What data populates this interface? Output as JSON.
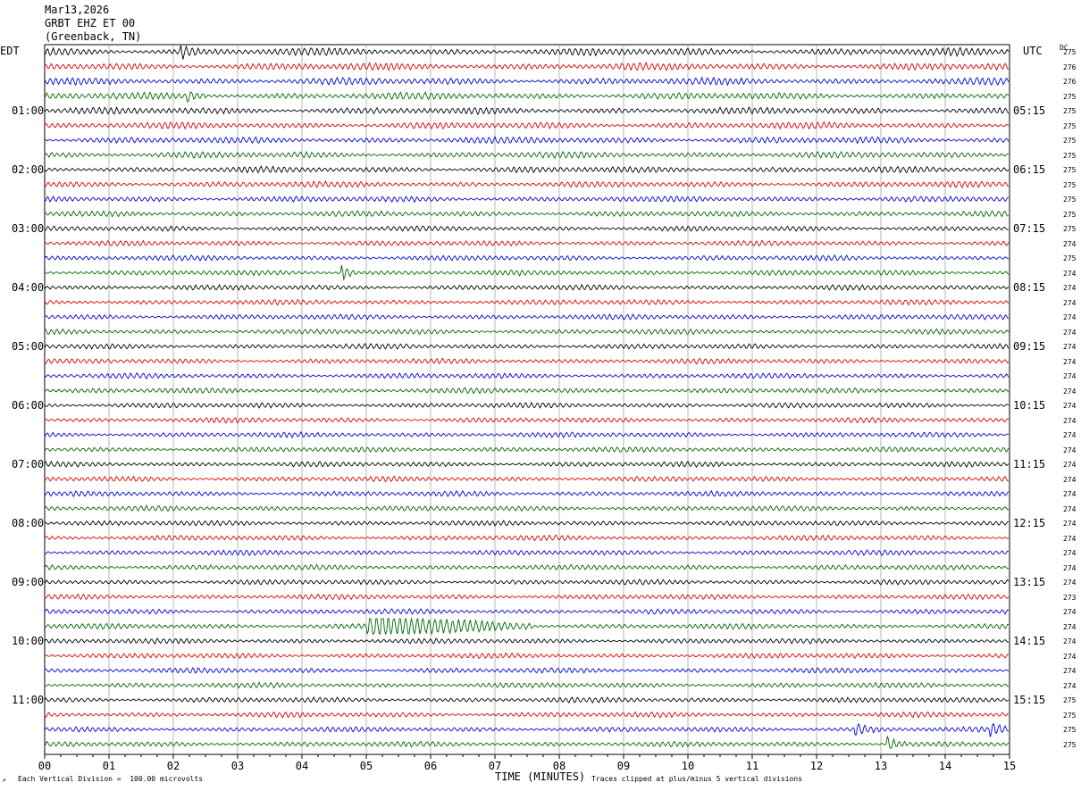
{
  "header": {
    "date": "Mar13,2026",
    "station": "GRBT EHZ ET 00",
    "location": "(Greenback, TN)"
  },
  "left_zone": "EDT",
  "right_zone": "UTC",
  "dc_header": "DC",
  "footer": {
    "scale_note": "Each Vertical Division =  100.00 microvolts",
    "xlabel": "TIME (MINUTES)",
    "clip_note": "Traces clipped at plus/minus 5 vertical divisions"
  },
  "colors": {
    "line_cycle": [
      "#000000",
      "#dd0000",
      "#0000dd",
      "#006600"
    ],
    "grid": "#888888"
  },
  "chart_data": {
    "type": "line",
    "title": "",
    "xlabel": "TIME (MINUTES)",
    "xlim": [
      0,
      15
    ],
    "x_ticks": [
      "00",
      "01",
      "02",
      "03",
      "04",
      "05",
      "06",
      "07",
      "08",
      "09",
      "10",
      "11",
      "12",
      "13",
      "14",
      "15"
    ],
    "trace_count": 48,
    "left_time_labels": [
      "01:00",
      "02:00",
      "03:00",
      "04:00",
      "05:00",
      "06:00",
      "07:00",
      "08:00",
      "09:00",
      "10:00",
      "11:00"
    ],
    "right_time_labels": [
      "05:15",
      "06:15",
      "07:15",
      "08:15",
      "09:15",
      "10:15",
      "11:15",
      "12:15",
      "13:15",
      "14:15",
      "15:15"
    ],
    "dc_values": [
      "275",
      "276",
      "276",
      "275",
      "275",
      "275",
      "275",
      "275",
      "275",
      "275",
      "275",
      "275",
      "275",
      "274",
      "275",
      "274",
      "274",
      "274",
      "274",
      "274",
      "274",
      "274",
      "274",
      "274",
      "274",
      "274",
      "274",
      "274",
      "274",
      "274",
      "274",
      "274",
      "274",
      "274",
      "274",
      "274",
      "274",
      "273",
      "274",
      "274",
      "274",
      "274",
      "274",
      "274",
      "275",
      "275",
      "275",
      "275"
    ],
    "events": [
      {
        "trace": 15,
        "start_min": 4.6,
        "end_min": 4.85,
        "amp": 2.0
      },
      {
        "trace": 39,
        "start_min": 5.0,
        "end_min": 7.6,
        "amp": 3.0
      },
      {
        "trace": 46,
        "start_min": 14.7,
        "end_min": 14.95,
        "amp": 1.6
      },
      {
        "trace": 46,
        "start_min": 12.6,
        "end_min": 13.0,
        "amp": 1.2
      },
      {
        "trace": 47,
        "start_min": 13.1,
        "end_min": 13.4,
        "amp": 1.5
      },
      {
        "trace": 0,
        "start_min": 2.1,
        "end_min": 2.4,
        "amp": 1.5
      },
      {
        "trace": 3,
        "start_min": 2.2,
        "end_min": 2.5,
        "amp": 1.4
      }
    ]
  }
}
